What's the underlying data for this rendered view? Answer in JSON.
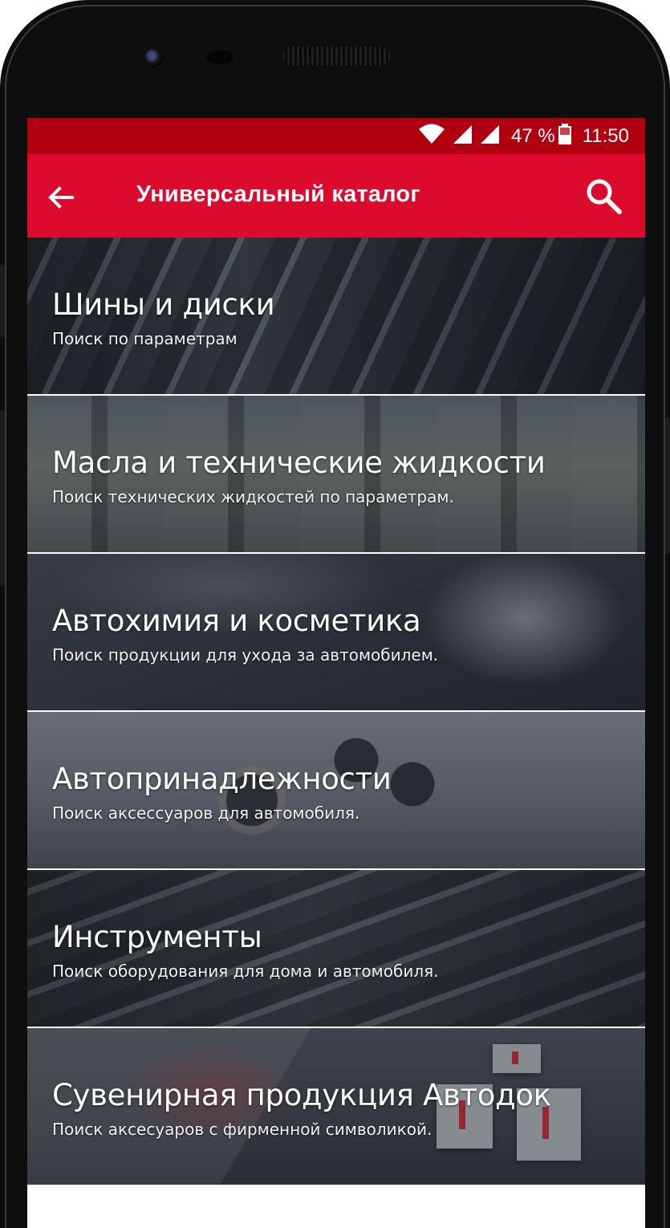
{
  "status_bar": {
    "battery_percent": "47 %",
    "time": "11:50",
    "color": "#b0000f"
  },
  "app_bar": {
    "title": "Универсальный каталог",
    "color": "#dc0a2d",
    "back_icon": "arrow-back-icon",
    "search_icon": "search-icon"
  },
  "categories": [
    {
      "title": "Шины и диски",
      "subtitle": "Поиск по параметрам"
    },
    {
      "title": "Масла и технические жидкости",
      "subtitle": "Поиск технических жидкостей по параметрам."
    },
    {
      "title": "Автохимия и косметика",
      "subtitle": "Поиск продукции для ухода за автомобилем."
    },
    {
      "title": "Автопринадлежности",
      "subtitle": "Поиск аксессуаров для автомобиля."
    },
    {
      "title": "Инструменты",
      "subtitle": "Поиск оборудования для дома и автомобиля."
    },
    {
      "title": "Сувенирная продукция Автодок",
      "subtitle": "Поиск аксесуаров с фирменной символикой."
    }
  ]
}
